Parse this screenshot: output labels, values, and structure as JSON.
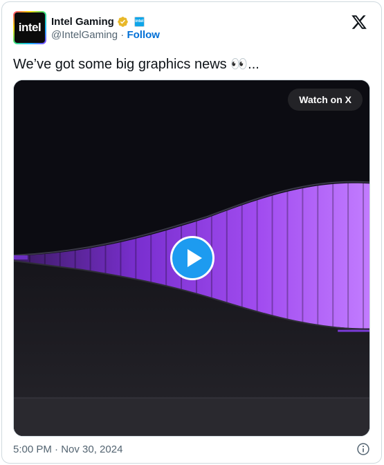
{
  "author": {
    "name": "Intel Gaming",
    "handle": "@IntelGaming",
    "separator": "·",
    "follow_label": "Follow",
    "avatar_text": "intel",
    "affiliate_badge_text": "intel",
    "verified_color": "#e8b829"
  },
  "tweet": {
    "text": "We’ve got some big graphics news 👀...",
    "timestamp": "5:00 PM · Nov 30, 2024"
  },
  "media": {
    "watch_label": "Watch on X",
    "play_color": "#1d9bf0",
    "glow_color": "#9b3df0"
  },
  "icons": {
    "x_logo": "x-logo-icon",
    "info": "info-icon",
    "verified": "verified-badge-icon",
    "play": "play-icon"
  }
}
